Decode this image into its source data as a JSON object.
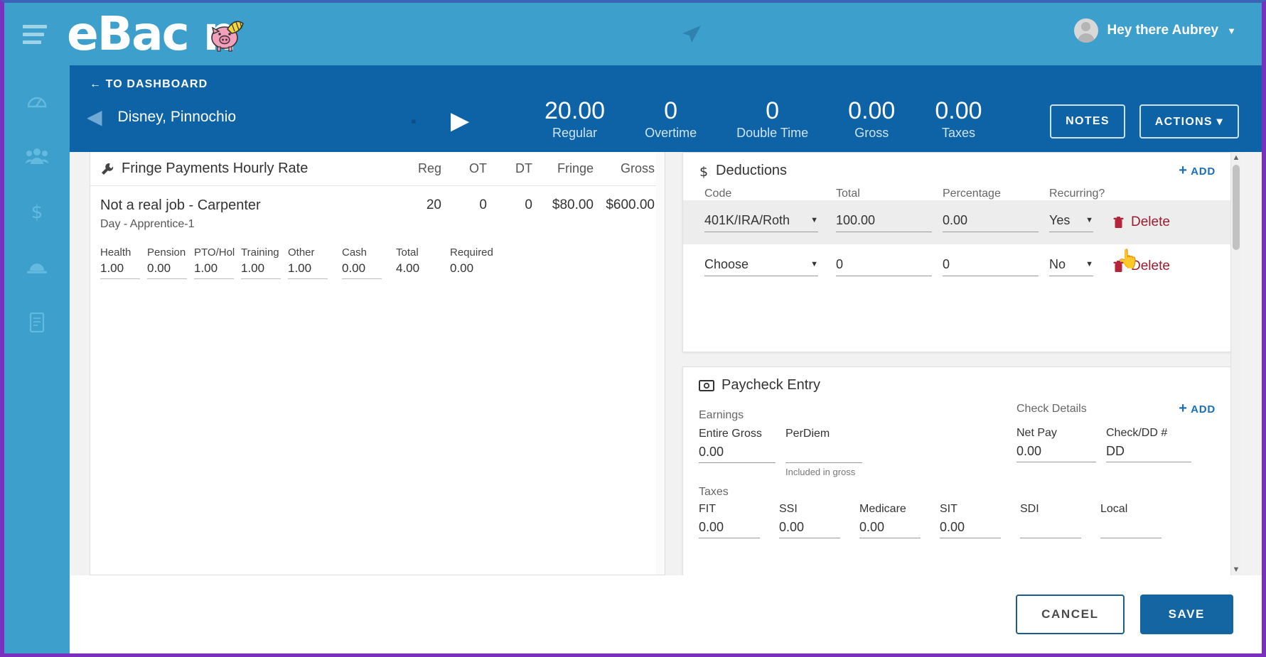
{
  "topbar": {
    "logo_text": "eBac n",
    "logo_name": "eBacon",
    "menu_icon": "hamburger-icon",
    "plane_icon": "paper-plane-icon",
    "user_greeting": "Hey there Aubrey",
    "user_caret": "▼"
  },
  "sidebar": {
    "items": [
      {
        "icon": "dashboard-gauge-icon",
        "name": "dashboard"
      },
      {
        "icon": "users-group-icon",
        "name": "employees"
      },
      {
        "icon": "dollar-icon",
        "name": "payroll"
      },
      {
        "icon": "hard-hat-icon",
        "name": "jobs"
      },
      {
        "icon": "document-icon",
        "name": "reports"
      }
    ]
  },
  "subheader": {
    "back_link": "TO DASHBOARD",
    "back_arrow": "←",
    "employee_name": "Disney, Pinnochio",
    "prev_arrow": "◀",
    "next_arrow": "▶",
    "stats": [
      {
        "value": "20.00",
        "label": "Regular"
      },
      {
        "value": "0",
        "label": "Overtime"
      },
      {
        "value": "0",
        "label": "Double Time"
      },
      {
        "value": "0.00",
        "label": "Gross"
      },
      {
        "value": "0.00",
        "label": "Taxes"
      }
    ],
    "notes_button": "NOTES",
    "actions_button": "ACTIONS",
    "actions_caret": "⌄"
  },
  "fringe_panel": {
    "icon": "wrench-icon",
    "title": "Fringe Payments Hourly Rate",
    "columns": [
      "Reg",
      "OT",
      "DT",
      "Fringe",
      "Gross"
    ],
    "job": {
      "title": "Not a real job - Carpenter",
      "subtitle": "Day - Apprentice-1",
      "reg": "20",
      "ot": "0",
      "dt": "0",
      "fringe": "$80.00",
      "gross": "$600.00"
    },
    "fringe_fields": [
      {
        "label": "Health",
        "value": "1.00"
      },
      {
        "label": "Pension",
        "value": "0.00"
      },
      {
        "label": "PTO/Hol",
        "value": "1.00"
      },
      {
        "label": "Training",
        "value": "1.00"
      },
      {
        "label": "Other",
        "value": "1.00"
      },
      {
        "label": "Cash",
        "value": "0.00"
      },
      {
        "label": "Total",
        "value": "4.00"
      },
      {
        "label": "Required",
        "value": "0.00"
      }
    ]
  },
  "deductions": {
    "icon": "dollar-icon",
    "title": "Deductions",
    "add_label": "ADD",
    "add_plus": "+",
    "columns": [
      "Code",
      "Total",
      "Percentage",
      "Recurring?"
    ],
    "rows": [
      {
        "code": "401K/IRA/Roth",
        "total": "100.00",
        "percentage": "0.00",
        "recurring": "Yes",
        "delete_label": "Delete",
        "selected": true
      },
      {
        "code": "Choose",
        "total": "0",
        "percentage": "0",
        "recurring": "No",
        "delete_label": "Delete",
        "selected": false
      }
    ]
  },
  "paycheck": {
    "icon": "money-icon",
    "title": "Paycheck Entry",
    "add_label": "ADD",
    "add_plus": "+",
    "earnings_label": "Earnings",
    "entire_gross_label": "Entire Gross",
    "entire_gross_value": "0.00",
    "perdiem_label": "PerDiem",
    "perdiem_value": "",
    "perdiem_note": "Included in gross",
    "check_details_label": "Check Details",
    "net_pay_label": "Net Pay",
    "net_pay_value": "0.00",
    "check_dd_label": "Check/DD #",
    "check_dd_value": "DD",
    "taxes_label": "Taxes",
    "taxes": [
      {
        "label": "FIT",
        "value": "0.00"
      },
      {
        "label": "SSI",
        "value": "0.00"
      },
      {
        "label": "Medicare",
        "value": "0.00"
      },
      {
        "label": "SIT",
        "value": "0.00"
      },
      {
        "label": "SDI",
        "value": ""
      },
      {
        "label": "Local",
        "value": ""
      }
    ]
  },
  "footer": {
    "cancel_label": "CANCEL",
    "save_label": "SAVE"
  },
  "colors": {
    "brand_light_blue": "#3d9fcc",
    "brand_dark_blue": "#0d63a5",
    "save_blue": "#1466a3",
    "delete_red": "#9b1c2e",
    "link_blue": "#1a6fb5",
    "page_border_purple": "#7b2fbe"
  }
}
